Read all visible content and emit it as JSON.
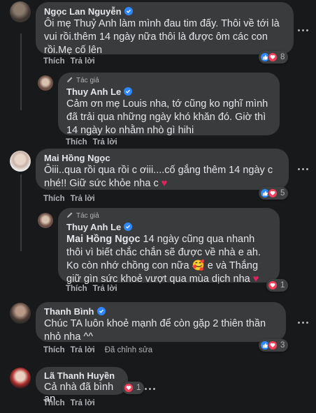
{
  "comments": [
    {
      "name": "Ngọc Lan Nguyễn",
      "text": "Ôi mẹ Thuỷ Anh làm mình đau tim đấy. Thôi về tới là vui rồi.thêm 14 ngày nữa thôi là được ôm các con rồi.Mẹ cố lên",
      "like": "Thích",
      "reply": "Trả lời",
      "reaction_count": "8"
    },
    {
      "author_tag": "Tác giả",
      "name": "Thuy Anh Le",
      "text": "Cảm ơn mẹ Louis nha, tớ cũng ko nghĩ mình đã trải qua những ngày khó khăn đó. Giờ thì 14 ngày ko nhằm nhò gì hihi",
      "like": "Thích",
      "reply": "Trả lời"
    },
    {
      "name": "Mai Hồng Ngọc",
      "text": "Ôiii..qua rồi qua rồi c ơiii....cố gắng thêm 14 ngày c nhé!! Giữ sức khỏe nha c",
      "like": "Thích",
      "reply": "Trả lời",
      "reaction_count": "5"
    },
    {
      "author_tag": "Tác giả",
      "name": "Thuy Anh Le",
      "mention": "Mai Hồng Ngọc",
      "text": " 14 ngày cũng qua nhanh thôi vì biết chắc chắn sẽ được về nhà e ah. Ko còn nhớ chồng con nữa",
      "text2": " e và Thắng giữ gìn sức khoẻ vượt qua mùa dịch nha",
      "like": "Thích",
      "reply": "Trả lời",
      "reaction_count": "1"
    },
    {
      "name": "Thanh Bình",
      "text": "Chúc TA luôn khoẻ mạnh để còn gặp 2 thiên thần nhỏ nha ^^",
      "like": "Thích",
      "reply": "Trả lời",
      "edited": "Đã chỉnh sửa",
      "reaction_count": "3"
    },
    {
      "name": "Lã Thanh Huyền",
      "text": "Cả nhà đã bình an.",
      "like": "Thích",
      "reply": "Trả lời",
      "reaction_count": "1"
    }
  ],
  "colors": {
    "background": "#18191a",
    "bubble": "#3a3b3c",
    "text": "#e4e6eb",
    "secondary": "#b0b3b8",
    "verified": "#2d88ff",
    "love": "#f33e58"
  },
  "icons": [
    "verified-badge-icon",
    "pencil-icon",
    "like-reaction-icon",
    "love-reaction-icon",
    "more-options-icon",
    "heart-emoji-icon",
    "smiling-face-with-hearts-emoji-icon"
  ]
}
